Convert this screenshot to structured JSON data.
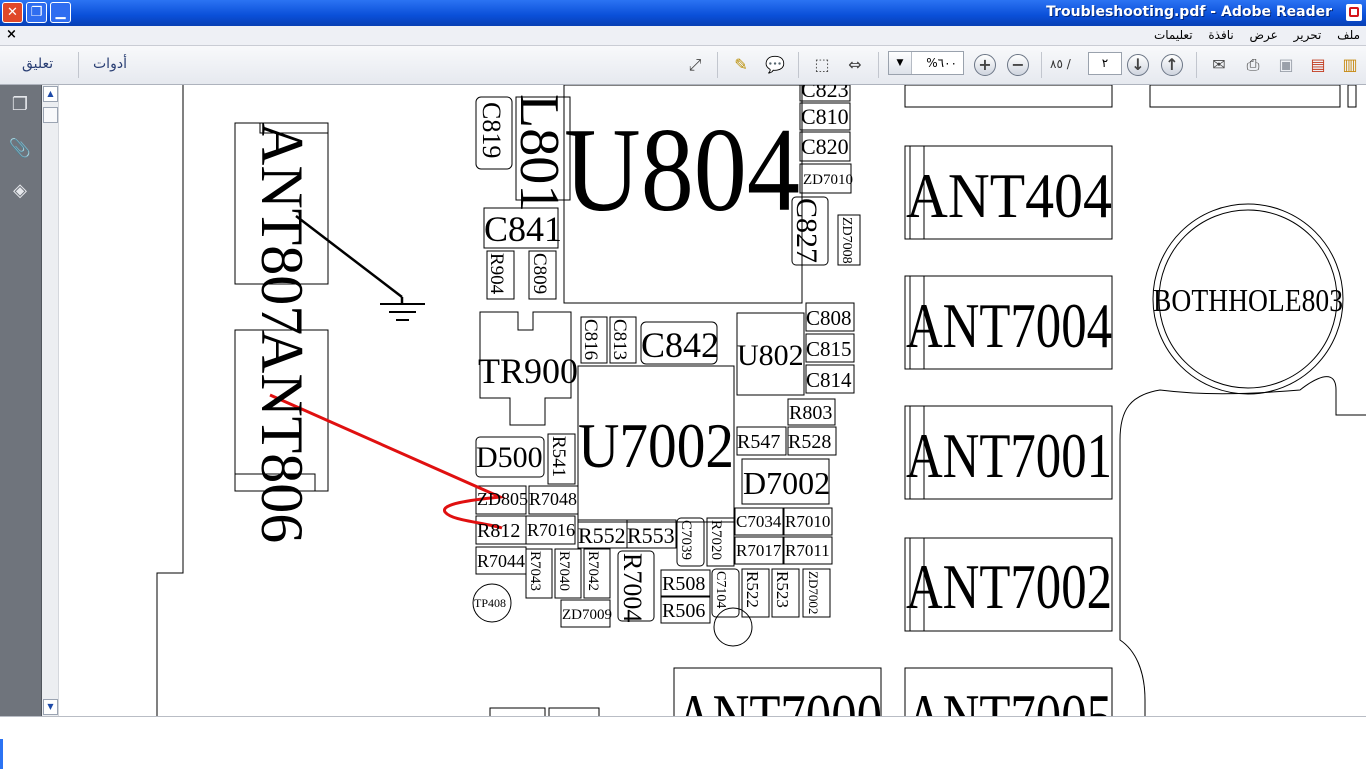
{
  "window": {
    "title": "Troubleshooting.pdf - Adobe Reader"
  },
  "menubar": {
    "close_mark": "×",
    "menus": [
      "ملف",
      "تحرير",
      "عرض",
      "نافذة",
      "تعليمات"
    ]
  },
  "toolbar": {
    "comment_label": "تعليق",
    "tools_label": "أدوات",
    "zoom_value": "%٦٠٠",
    "page_current": "٢",
    "page_total": "٨٥",
    "page_separator": "/"
  },
  "colors": {
    "title_bar": "#0a4fd8",
    "arrow_red": "#e01010"
  },
  "schematic": {
    "labels": [
      "ANT807",
      "ANT806",
      "C819",
      "L801",
      "U804",
      "C823",
      "C810",
      "C820",
      "ZD7010",
      "C827",
      "ZD7008",
      "C841",
      "R904",
      "C809",
      "TR900",
      "C816",
      "C813",
      "C842",
      "U802",
      "C808",
      "C815",
      "C814",
      "R803",
      "D500",
      "R541",
      "U7002",
      "R547",
      "R528",
      "D7002",
      "ZD805",
      "R7048",
      "R812",
      "R7016",
      "R552",
      "R553",
      "C7039",
      "R7020",
      "C7034",
      "R7010",
      "R7017",
      "R7011",
      "R7044",
      "R7043",
      "R7040",
      "R7042",
      "R7004",
      "R508",
      "C7104",
      "R522",
      "R523",
      "ZD7002",
      "TP408",
      "R506",
      "ZD7009",
      "ANT404",
      "ANT7004",
      "ANT7001",
      "ANT7002",
      "ANT7000",
      "ANT7005",
      "BOTHHOLE803"
    ]
  }
}
